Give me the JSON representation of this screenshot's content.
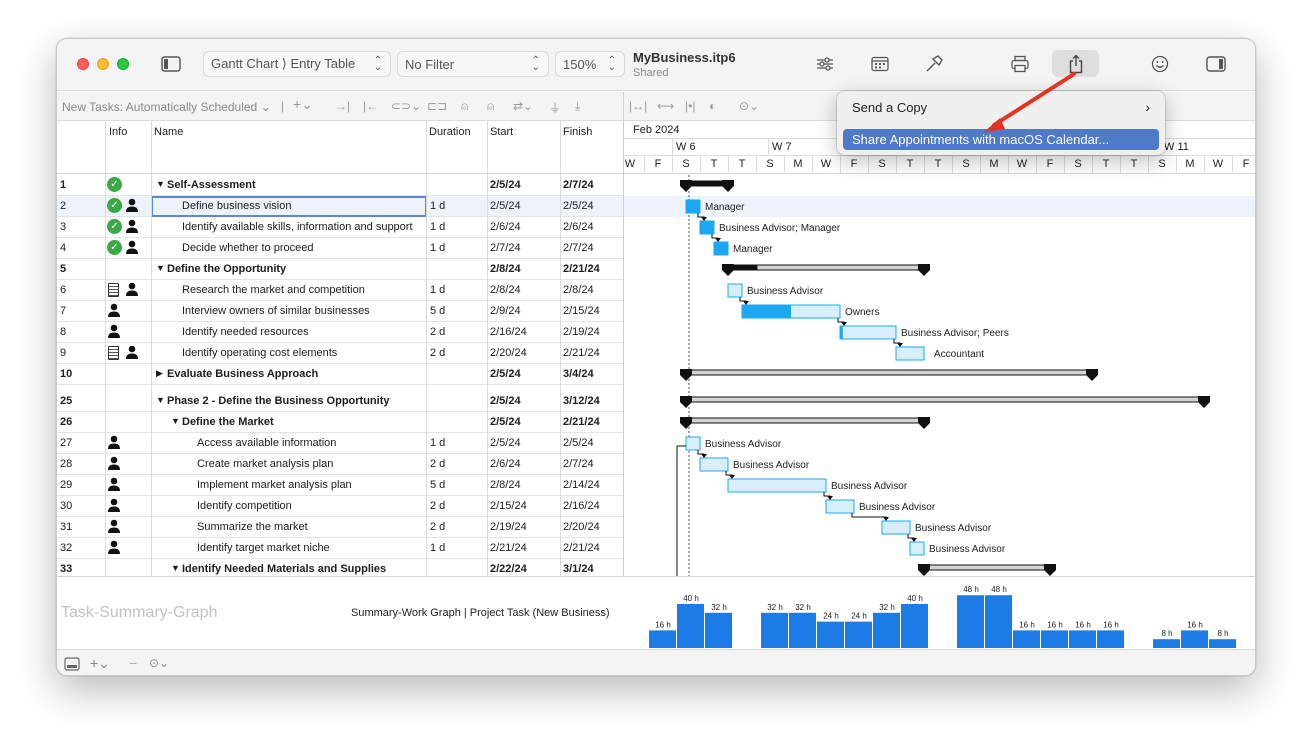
{
  "toolbar": {
    "view_selector": "Gantt Chart ⟩ Entry Table",
    "filter": "No Filter",
    "zoom": "150%",
    "doc_title": "MyBusiness.itp6",
    "doc_status": "Shared"
  },
  "toolbar2": {
    "schedule_mode": "New Tasks: Automatically Scheduled"
  },
  "table": {
    "headers": {
      "info": "Info",
      "name": "Name",
      "duration": "Duration",
      "start": "Start",
      "finish": "Finish"
    },
    "rows": [
      {
        "id": "1",
        "name": "Self-Assessment",
        "duration": "",
        "start": "2/5/24",
        "finish": "2/7/24",
        "bold": true,
        "level": 0,
        "tri": "▼",
        "icons": [
          "check"
        ]
      },
      {
        "id": "2",
        "name": "Define business vision",
        "duration": "1 d",
        "start": "2/5/24",
        "finish": "2/5/24",
        "bold": false,
        "level": 1,
        "tri": "",
        "icons": [
          "check",
          "person"
        ],
        "selected": true
      },
      {
        "id": "3",
        "name": "Identify available skills, information and support",
        "duration": "1 d",
        "start": "2/6/24",
        "finish": "2/6/24",
        "bold": false,
        "level": 1,
        "tri": "",
        "icons": [
          "check",
          "person"
        ]
      },
      {
        "id": "4",
        "name": "Decide whether to proceed",
        "duration": "1 d",
        "start": "2/7/24",
        "finish": "2/7/24",
        "bold": false,
        "level": 1,
        "tri": "",
        "icons": [
          "check",
          "person"
        ]
      },
      {
        "id": "5",
        "name": "Define the Opportunity",
        "duration": "",
        "start": "2/8/24",
        "finish": "2/21/24",
        "bold": true,
        "level": 0,
        "tri": "▼",
        "icons": []
      },
      {
        "id": "6",
        "name": "Research the market and competition",
        "duration": "1 d",
        "start": "2/8/24",
        "finish": "2/8/24",
        "bold": false,
        "level": 1,
        "tri": "",
        "icons": [
          "note",
          "person"
        ]
      },
      {
        "id": "7",
        "name": "Interview owners of similar businesses",
        "duration": "5 d",
        "start": "2/9/24",
        "finish": "2/15/24",
        "bold": false,
        "level": 1,
        "tri": "",
        "icons": [
          "person"
        ]
      },
      {
        "id": "8",
        "name": "Identify needed resources",
        "duration": "2 d",
        "start": "2/16/24",
        "finish": "2/19/24",
        "bold": false,
        "level": 1,
        "tri": "",
        "icons": [
          "person"
        ]
      },
      {
        "id": "9",
        "name": "Identify operating cost elements",
        "duration": "2 d",
        "start": "2/20/24",
        "finish": "2/21/24",
        "bold": false,
        "level": 1,
        "tri": "",
        "icons": [
          "note",
          "person"
        ]
      },
      {
        "id": "10",
        "name": "Evaluate Business Approach",
        "duration": "",
        "start": "2/5/24",
        "finish": "3/4/24",
        "bold": true,
        "level": 0,
        "tri": "▶",
        "icons": [],
        "gap": true
      },
      {
        "id": "25",
        "name": "Phase 2 - Define the Business Opportunity",
        "duration": "",
        "start": "2/5/24",
        "finish": "3/12/24",
        "bold": true,
        "level": 0,
        "tri": "▼",
        "icons": []
      },
      {
        "id": "26",
        "name": "Define the Market",
        "duration": "",
        "start": "2/5/24",
        "finish": "2/21/24",
        "bold": true,
        "level": 1,
        "tri": "▼",
        "icons": []
      },
      {
        "id": "27",
        "name": "Access available information",
        "duration": "1 d",
        "start": "2/5/24",
        "finish": "2/5/24",
        "bold": false,
        "level": 2,
        "tri": "",
        "icons": [
          "person"
        ]
      },
      {
        "id": "28",
        "name": "Create market analysis plan",
        "duration": "2 d",
        "start": "2/6/24",
        "finish": "2/7/24",
        "bold": false,
        "level": 2,
        "tri": "",
        "icons": [
          "person"
        ]
      },
      {
        "id": "29",
        "name": "Implement market analysis plan",
        "duration": "5 d",
        "start": "2/8/24",
        "finish": "2/14/24",
        "bold": false,
        "level": 2,
        "tri": "",
        "icons": [
          "person"
        ]
      },
      {
        "id": "30",
        "name": "Identify competition",
        "duration": "2 d",
        "start": "2/15/24",
        "finish": "2/16/24",
        "bold": false,
        "level": 2,
        "tri": "",
        "icons": [
          "person"
        ]
      },
      {
        "id": "31",
        "name": "Summarize the market",
        "duration": "2 d",
        "start": "2/19/24",
        "finish": "2/20/24",
        "bold": false,
        "level": 2,
        "tri": "",
        "icons": [
          "person"
        ]
      },
      {
        "id": "32",
        "name": "Identify target market niche",
        "duration": "1 d",
        "start": "2/21/24",
        "finish": "2/21/24",
        "bold": false,
        "level": 2,
        "tri": "",
        "icons": [
          "person"
        ]
      },
      {
        "id": "33",
        "name": "Identify Needed Materials and Supplies",
        "duration": "",
        "start": "2/22/24",
        "finish": "3/1/24",
        "bold": true,
        "level": 1,
        "tri": "▼",
        "icons": []
      }
    ]
  },
  "gantt": {
    "month": "Feb 2024",
    "weeks": [
      "W 6",
      "W 7",
      "W 11"
    ],
    "days": [
      "W",
      "F",
      "S",
      "T",
      "T",
      "S",
      "M",
      "W",
      "F",
      "S",
      "T",
      "T",
      "S",
      "M",
      "W",
      "F",
      "S",
      "T",
      "T",
      "S",
      "M",
      "W",
      "F"
    ],
    "bars": [
      {
        "type": "summary",
        "start": 2,
        "len": 1.5,
        "fill": 1
      },
      {
        "type": "task",
        "start": 2,
        "len": 0.5,
        "prog": 1,
        "label": "Manager"
      },
      {
        "type": "task",
        "start": 2.5,
        "len": 0.5,
        "prog": 1,
        "label": "Business Advisor; Manager"
      },
      {
        "type": "task",
        "start": 3,
        "len": 0.5,
        "prog": 1,
        "label": "Manager"
      },
      {
        "type": "summary",
        "start": 3.5,
        "len": 7,
        "fill": 0.15
      },
      {
        "type": "task",
        "start": 3.5,
        "len": 0.5,
        "prog": 0,
        "label": "Business Advisor"
      },
      {
        "type": "task",
        "start": 4,
        "len": 3.5,
        "prog": 0.5,
        "label": "Owners"
      },
      {
        "type": "task",
        "start": 7.5,
        "len": 2,
        "prog": 0.05,
        "label": "Business Advisor; Peers"
      },
      {
        "type": "task",
        "start": 9.5,
        "len": 1,
        "prog": 0,
        "label": "Accountant"
      },
      {
        "type": "summary",
        "start": 2,
        "len": 14.5,
        "fill": 0
      },
      {
        "type": "summary",
        "start": 2,
        "len": 18.5,
        "fill": 0
      },
      {
        "type": "summary",
        "start": 2,
        "len": 8.5,
        "fill": 0
      },
      {
        "type": "task",
        "start": 2,
        "len": 0.5,
        "prog": 0,
        "label": "Business Advisor"
      },
      {
        "type": "task",
        "start": 2.5,
        "len": 1,
        "prog": 0,
        "label": "Business Advisor"
      },
      {
        "type": "task",
        "start": 3.5,
        "len": 3.5,
        "prog": 0,
        "label": "Business Advisor"
      },
      {
        "type": "task",
        "start": 7,
        "len": 1,
        "prog": 0,
        "label": "Business Advisor"
      },
      {
        "type": "task",
        "start": 9,
        "len": 1,
        "prog": 0,
        "label": "Business Advisor"
      },
      {
        "type": "task",
        "start": 10,
        "len": 0.5,
        "prog": 0,
        "label": "Business Advisor"
      },
      {
        "type": "summary",
        "start": 10.5,
        "len": 4.5,
        "fill": 0
      }
    ]
  },
  "graph": {
    "title": "Task-Summary-Graph",
    "caption": "Summary-Work Graph | Project Task (New Business)",
    "bars": [
      {
        "day": 1.5,
        "h": 16,
        "label": "16 h"
      },
      {
        "day": 2.5,
        "h": 40,
        "label": "40 h"
      },
      {
        "day": 3.5,
        "h": 32,
        "label": "32 h"
      },
      {
        "day": 5.5,
        "h": 32,
        "label": "32 h"
      },
      {
        "day": 6.5,
        "h": 32,
        "label": "32 h"
      },
      {
        "day": 7.5,
        "h": 24,
        "label": "24 h"
      },
      {
        "day": 8.5,
        "h": 24,
        "label": "24 h"
      },
      {
        "day": 9.5,
        "h": 32,
        "label": "32 h"
      },
      {
        "day": 10.5,
        "h": 40,
        "label": "40 h"
      },
      {
        "day": 12.5,
        "h": 48,
        "label": "48 h"
      },
      {
        "day": 13.5,
        "h": 48,
        "label": "48 h"
      },
      {
        "day": 14.5,
        "h": 16,
        "label": "16 h"
      },
      {
        "day": 15.5,
        "h": 16,
        "label": "16 h"
      },
      {
        "day": 16.5,
        "h": 16,
        "label": "16 h"
      },
      {
        "day": 17.5,
        "h": 16,
        "label": "16 h"
      },
      {
        "day": 19.5,
        "h": 8,
        "label": "8 h"
      },
      {
        "day": 20.5,
        "h": 16,
        "label": "16 h"
      },
      {
        "day": 21.5,
        "h": 8,
        "label": "8 h"
      }
    ]
  },
  "share_menu": {
    "send_copy": "Send a Copy",
    "share_calendar": "Share Appointments with macOS Calendar..."
  },
  "colors": {
    "accent": "#4f7ac7",
    "task_fill": "#d8effb",
    "task_progress": "#1da7f0",
    "graph_bar": "#1d7be6",
    "annotation_arrow": "#e8321f"
  }
}
